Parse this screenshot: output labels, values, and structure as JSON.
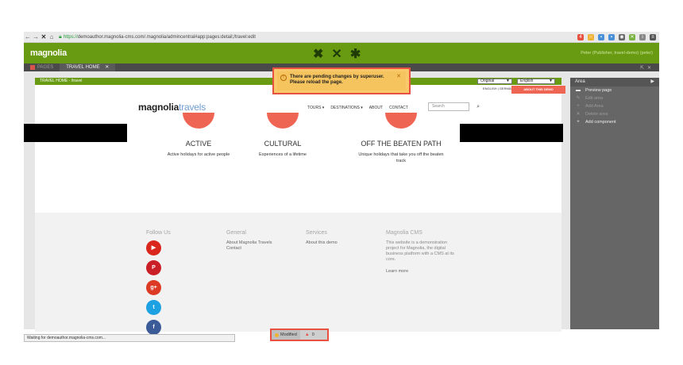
{
  "browser": {
    "url_https": "https://",
    "url_rest": "demoauthor.magnolia-cms.com/.magnolia/admincentral#app:pages:detail;/travel:edit",
    "status_text": "Waiting for demoauthor.magnolia-cms.com..."
  },
  "header": {
    "logo": "magnolia",
    "user": "Peter (Publisher, travel-demo) (peter)"
  },
  "tabs": [
    {
      "label": "PAGES"
    },
    {
      "label": "TRAVEL HOME"
    }
  ],
  "notification": {
    "line1": "There are pending changes by superuser.",
    "line2": "Please reload the page."
  },
  "page": {
    "breadcrumb": "TRAVEL HOME - /travel",
    "select_original": "Original",
    "select_language": "English",
    "lang_line": "ENGLISH | GERMAN",
    "about_demo": "ABOUT THIS DEMO",
    "site_logo_a": "magnolia",
    "site_logo_b": "travels",
    "nav": [
      "TOURS ▾",
      "DESTINATIONS ▾",
      "ABOUT",
      "CONTACT"
    ],
    "search_placeholder": "Search",
    "categories": [
      {
        "title": "ACTIVE",
        "desc": "Active holidays for active people"
      },
      {
        "title": "CULTURAL",
        "desc": "Experiences of a lifetime"
      },
      {
        "title": "OFF THE BEATEN PATH",
        "desc": "Unique holidays that take you off the beaten track"
      }
    ],
    "footer": {
      "follow": "Follow Us",
      "general": "General",
      "general_links": [
        "About Magnolia Travels",
        "Contact"
      ],
      "services": "Services",
      "services_links": [
        "About this demo"
      ],
      "cms": "Magnolia CMS",
      "cms_text": "This website is a demonstration project for Magnolia, the digital business platform with a  CMS at its core.",
      "learn_more": "Learn more"
    }
  },
  "panel": {
    "title": "Area",
    "items": [
      {
        "label": "Preview page",
        "icon": "preview-icon",
        "enabled": true
      },
      {
        "label": "Edit area",
        "icon": "edit-icon",
        "enabled": false
      },
      {
        "label": "Add Area",
        "icon": "plus-icon",
        "enabled": false
      },
      {
        "label": "Delete area",
        "icon": "close-icon",
        "enabled": false
      },
      {
        "label": "Add component",
        "icon": "plus-icon",
        "enabled": true
      }
    ]
  },
  "bottom": {
    "modified": "Modified",
    "warnings": "0"
  },
  "colors": {
    "magnolia_green": "#689a12",
    "accent_red": "#ef6554",
    "highlight_border": "#e8503f",
    "notice_bg": "#f6c45f"
  }
}
